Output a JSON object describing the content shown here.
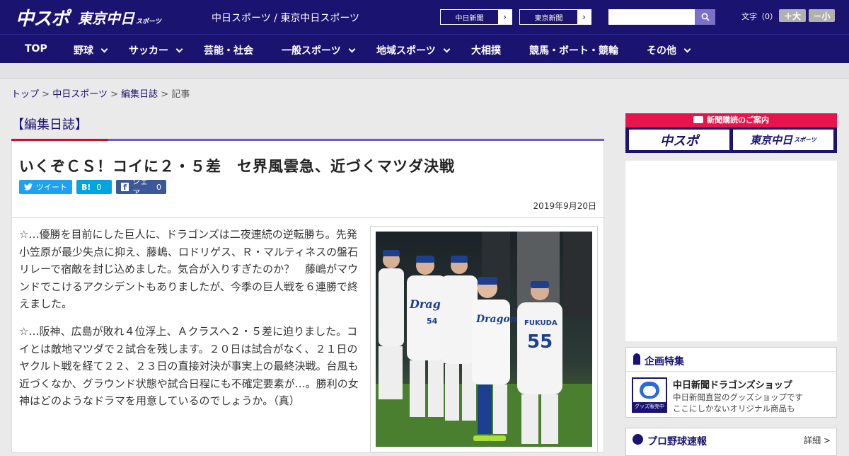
{
  "header": {
    "logo_chunichi_sports": "中スポ",
    "logo_tokyo_chunichi": "東京中日",
    "logo_tokyo_suffix": "スポーツ",
    "site_name": "中日スポーツ / 東京中日スポーツ",
    "paper_buttons": [
      "中日新聞",
      "東京新聞"
    ],
    "search_placeholder": "",
    "font_size_label": "文字（0）",
    "font_bigger": "＋大",
    "font_smaller": "－小"
  },
  "nav": {
    "items": [
      {
        "label": "TOP",
        "dropdown": false
      },
      {
        "label": "野球",
        "dropdown": true
      },
      {
        "label": "サッカー",
        "dropdown": true
      },
      {
        "label": "芸能・社会",
        "dropdown": false
      },
      {
        "label": "一般スポーツ",
        "dropdown": true
      },
      {
        "label": "地域スポーツ",
        "dropdown": true
      },
      {
        "label": "大相撲",
        "dropdown": false
      },
      {
        "label": "競馬・ボート・競輪",
        "dropdown": false
      },
      {
        "label": "その他",
        "dropdown": true
      }
    ]
  },
  "breadcrumb": {
    "items": [
      "トップ",
      "中日スポーツ",
      "編集日誌"
    ],
    "current": "記事",
    "separator": ">"
  },
  "category": "【編集日誌】",
  "article": {
    "title": "いくぞＣＳ！コイに２・５差　セ界風雲急、近づくマツダ決戦",
    "share": {
      "tweet_label": "ツイート",
      "hatena_label": "B!",
      "hatena_count": "0",
      "facebook_label": "シェア",
      "facebook_count": "0"
    },
    "date": "2019年9月20日",
    "paragraphs": [
      "☆…優勝を目前にした巨人に、ドラゴンズは二夜連続の逆転勝ち。先発小笠原が最少失点に抑え、藤嶋、ロドリゲス、Ｒ・マルティネスの盤石リレーで宿敵を封じ込めました。気合が入りすぎたのか？　藤嶋がマウンドでこけるアクシデントもありましたが、今季の巨人戦を６連勝で終えました。",
      "☆…阪神、広島が敗れ４位浮上、Ａクラスへ２・５差に迫りました。コイとは敵地マツダで２試合を残します。２０日は試合がなく、２１日のヤクルト戦を経て２２、２３日の直接対決が事実上の最終決戦。台風も近づくなか、グラウンド状態や試合日程にも不確定要素が…。勝利の女神はどのようなドラマを用意しているのでしょうか。（真）"
    ],
    "photo": {
      "jersey_text": "Dragons",
      "player_name": "FUKUDA",
      "player_number": "55",
      "other_number": "54"
    }
  },
  "sidebar": {
    "subscription_title": "新聞購読のご案内",
    "subscription_logos": [
      "中スポ",
      "東京中日"
    ],
    "subscription_logo_suffix": "スポーツ",
    "feature": {
      "title": "企画特集",
      "item_title": "中日新聞ドラゴンズショップ",
      "item_desc1": "中日新聞直営のグッズショップです",
      "item_desc2": "ここにしかないオリジナル商品も",
      "thumb_label": "グッズ販売中"
    },
    "pro_baseball": {
      "title": "プロ野球速報",
      "detail_label": "詳細 >"
    }
  },
  "colors": {
    "brand_navy": "#1a1370",
    "accent_red": "#c8102e",
    "accent_purple": "#6a5fbf",
    "twitter": "#1da1f2",
    "hatena": "#00a4de",
    "facebook": "#3b5998",
    "subscription_pink": "#e8154c"
  }
}
